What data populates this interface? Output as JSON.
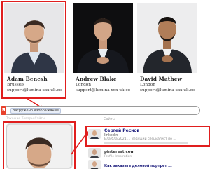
{
  "cards": [
    {
      "name": "Adam Benesh",
      "city": "Brussels",
      "email": "support@lumina-xxx-uk.co"
    },
    {
      "name": "Andrew Blake",
      "city": "London",
      "email": "support@lumina-xxx-uk.co"
    },
    {
      "name": "David Mathew",
      "city": "London",
      "email": "support@lumina-xxx-uk.co"
    }
  ],
  "search": {
    "logo": "Я",
    "chip_label": "Загружено изображение",
    "chip_close": "✕",
    "faint_tabs": "Похожие   Товары   Сайты"
  },
  "results": {
    "header_partial": "Сайты",
    "r1_title": "Сергей Реснов",
    "r1_site": "linkedin",
    "r1_desc": "Бла-бла 2021 ... Ведущий специалист по ...",
    "r2_site": "pinterest.com",
    "r2_sub": "Profile Inspiration",
    "r3_title": "Как заказать деловой портрет ..."
  },
  "colors": {
    "highlight": "#e01e1e",
    "logo": "#e8412c"
  }
}
